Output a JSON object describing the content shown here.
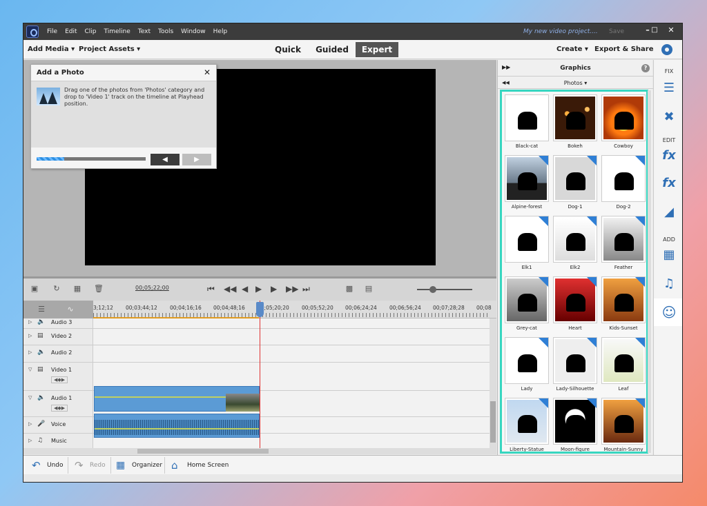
{
  "window": {
    "menus": [
      "File",
      "Edit",
      "Clip",
      "Timeline",
      "Text",
      "Tools",
      "Window",
      "Help"
    ],
    "project_title": "My new video project....",
    "save_label": "Save",
    "min": "–",
    "max": "□",
    "close": "✕"
  },
  "modebar": {
    "add_media": "Add Media ▾",
    "project_assets": "Project Assets ▾",
    "tabs": [
      "Quick",
      "Guided",
      "Expert"
    ],
    "active_tab": "Expert",
    "create": "Create ▾",
    "export": "Export & Share"
  },
  "popup": {
    "title": "Add a Photo",
    "close": "✕",
    "text": "Drag one of the photos from 'Photos' category and drop to 'Video 1' track on the timeline at Playhead position.",
    "progress": 0.25,
    "prev": "◀",
    "next": "▶"
  },
  "timeline": {
    "timecode": "00;05;22;00",
    "ruler": [
      "3;12;12",
      "00;03;44;12",
      "00;04;16;16",
      "00;04;48;16",
      "00;05;20;20",
      "00;05;52;20",
      "00;06;24;24",
      "00;06;56;24",
      "00;07;28;28",
      "00;08"
    ],
    "tracks": [
      "Audio 3",
      "Video 2",
      "Audio 2",
      "Video 1",
      "Audio 1",
      "Voice",
      "Music"
    ]
  },
  "bottombar": {
    "undo": "Undo",
    "redo": "Redo",
    "organizer": "Organizer",
    "home": "Home Screen"
  },
  "panel": {
    "title": "Graphics",
    "help": "?",
    "category": "Photos ▾",
    "photos": [
      "Black-cat",
      "Bokeh",
      "Cowboy",
      "Alpine-forest",
      "Dog-1",
      "Dog-2",
      "Elk1",
      "Elk2",
      "Feather",
      "Grey-cat",
      "Heart",
      "Kids-Sunset",
      "Lady",
      "Lady-Silhouette",
      "Leaf",
      "Liberty-Statue",
      "Moon-figure",
      "Mountain-Sunny"
    ]
  },
  "rail": {
    "fix": "FIX",
    "edit": "EDIT",
    "add": "ADD"
  }
}
